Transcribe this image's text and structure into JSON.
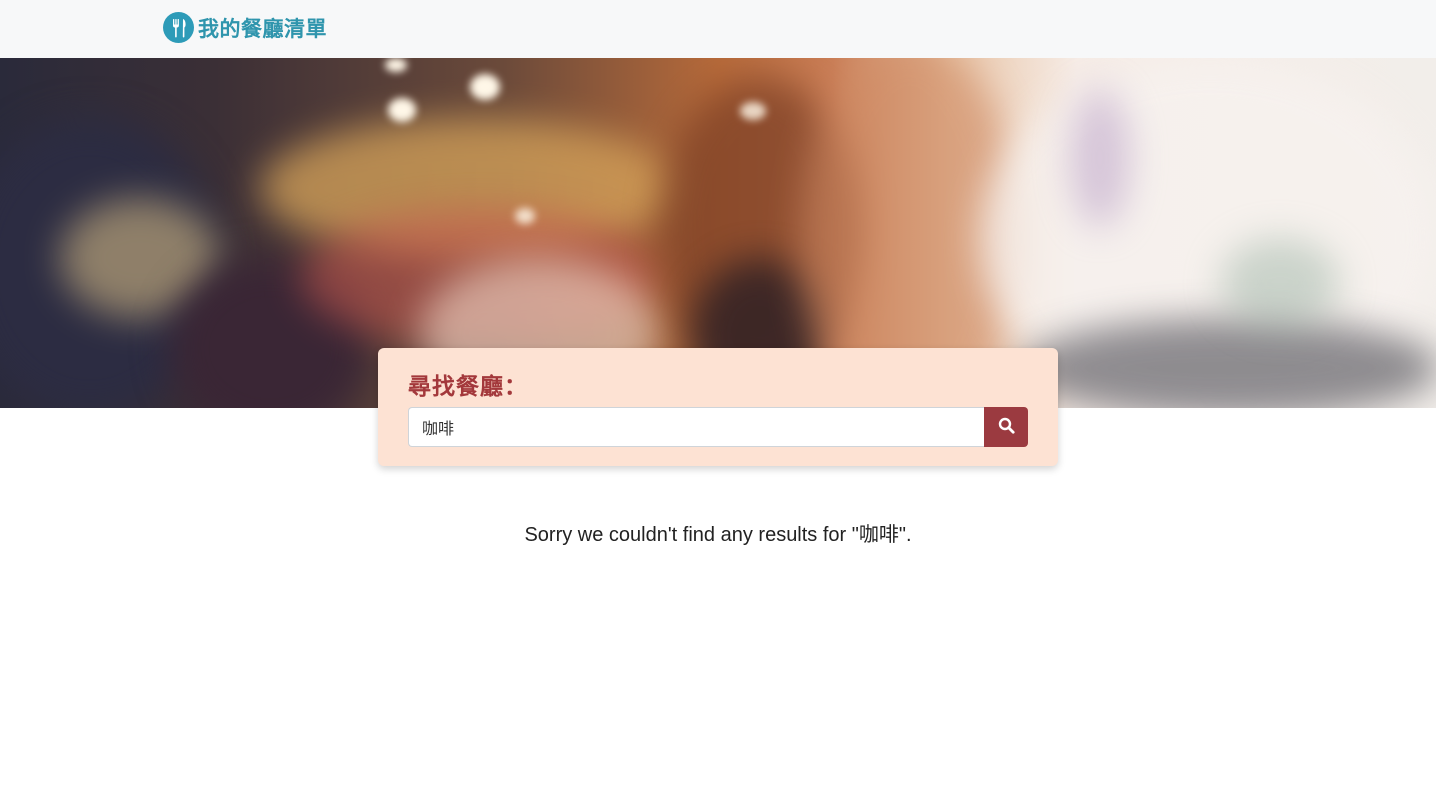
{
  "navbar": {
    "brand_title": "我的餐廳清單",
    "logo_icon": "fork-knife-icon"
  },
  "banner": {
    "image": "blurred-restaurant-interior-photo"
  },
  "search": {
    "label": "尋找餐廳：",
    "value": "咖啡",
    "button_icon": "search-icon"
  },
  "results": {
    "message": "Sorry we couldn't find any results for \"咖啡\"."
  },
  "colors": {
    "brand": "#2f95ad",
    "accent": "#9b3a40",
    "card_bg": "#fde2d3",
    "nav_bg": "#f7f8f9"
  }
}
